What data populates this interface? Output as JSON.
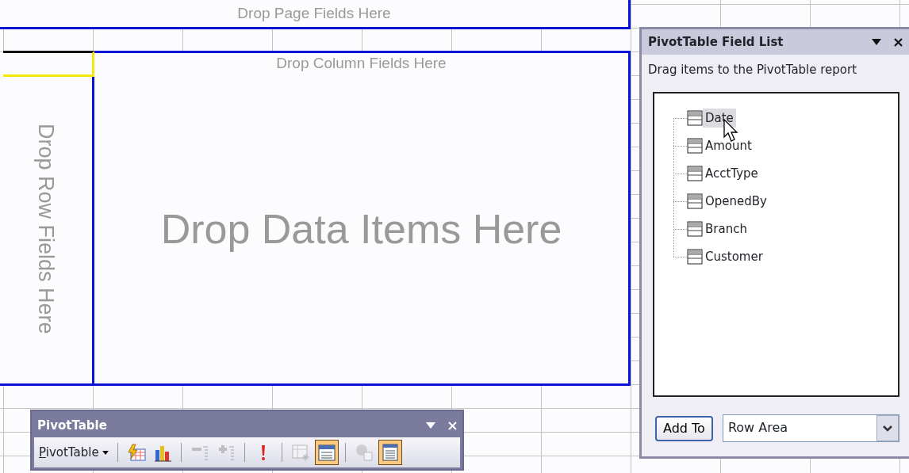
{
  "sheet": {
    "page_area": "Drop Page Fields Here",
    "column_area": "Drop Column Fields Here",
    "row_area": "Drop Row Fields Here",
    "data_area": "Drop Data Items Here"
  },
  "field_list": {
    "title": "PivotTable Field List",
    "instruction": "Drag items to the PivotTable report",
    "fields": [
      {
        "label": "Date",
        "selected": true
      },
      {
        "label": "Amount",
        "selected": false
      },
      {
        "label": "AcctType",
        "selected": false
      },
      {
        "label": "OpenedBy",
        "selected": false
      },
      {
        "label": "Branch",
        "selected": false
      },
      {
        "label": "Customer",
        "selected": false
      }
    ],
    "add_button": "Add To",
    "area_select": {
      "value": "Row Area"
    }
  },
  "toolbar": {
    "title": "PivotTable",
    "menu": "PivotTable",
    "groups": [
      [
        {
          "kind": "format",
          "disabled": false,
          "on": false
        },
        {
          "kind": "chart",
          "disabled": false,
          "on": false
        }
      ],
      [
        {
          "kind": "hide",
          "disabled": true,
          "on": false
        },
        {
          "kind": "show",
          "disabled": true,
          "on": false
        }
      ],
      [
        {
          "kind": "refresh",
          "disabled": false,
          "on": false
        }
      ],
      [
        {
          "kind": "settings",
          "disabled": true,
          "on": false
        },
        {
          "kind": "fieldlist",
          "disabled": false,
          "on": true
        }
      ],
      [
        {
          "kind": "info",
          "disabled": true,
          "on": false
        },
        {
          "kind": "window",
          "disabled": false,
          "on": true
        }
      ]
    ]
  }
}
